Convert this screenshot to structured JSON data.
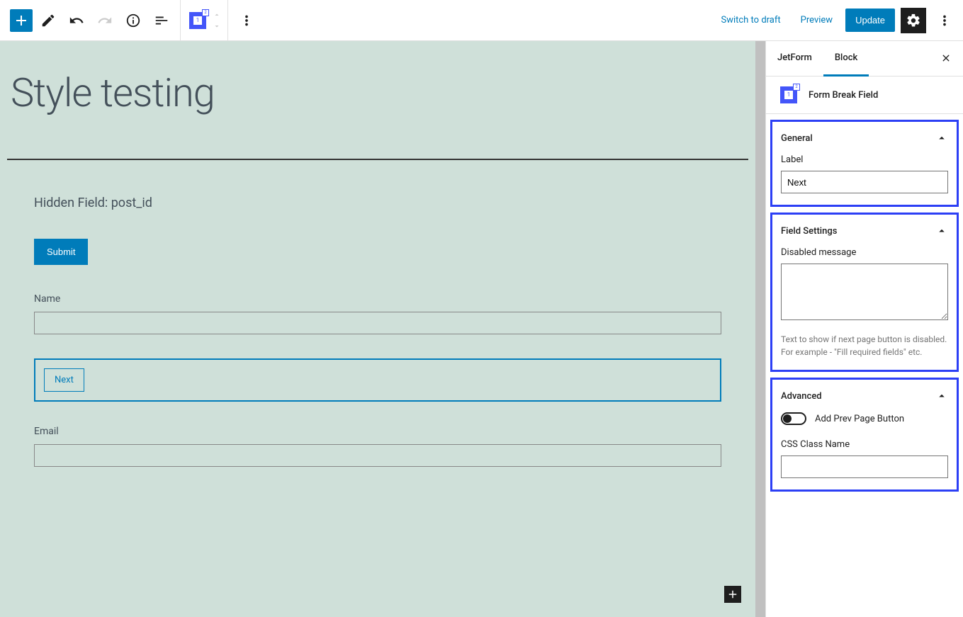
{
  "toolbar": {
    "switch_draft": "Switch to draft",
    "preview": "Preview",
    "update": "Update"
  },
  "editor": {
    "page_title": "Style testing",
    "hidden_field_label": "Hidden Field: post_id",
    "submit_label": "Submit",
    "fields": {
      "name_label": "Name",
      "name_value": "",
      "email_label": "Email",
      "email_value": ""
    },
    "next_label": "Next"
  },
  "sidebar": {
    "tabs": {
      "jetform": "JetForm",
      "block": "Block"
    },
    "block_title": "Form Break Field",
    "panels": {
      "general": {
        "title": "General",
        "label_field": "Label",
        "label_value": "Next"
      },
      "field_settings": {
        "title": "Field Settings",
        "disabled_msg_label": "Disabled message",
        "disabled_msg_value": "",
        "help_text": "Text to show if next page button is disabled. For example - \"Fill required fields\" etc."
      },
      "advanced": {
        "title": "Advanced",
        "prev_page_label": "Add Prev Page Button",
        "css_class_label": "CSS Class Name",
        "css_class_value": ""
      }
    }
  }
}
